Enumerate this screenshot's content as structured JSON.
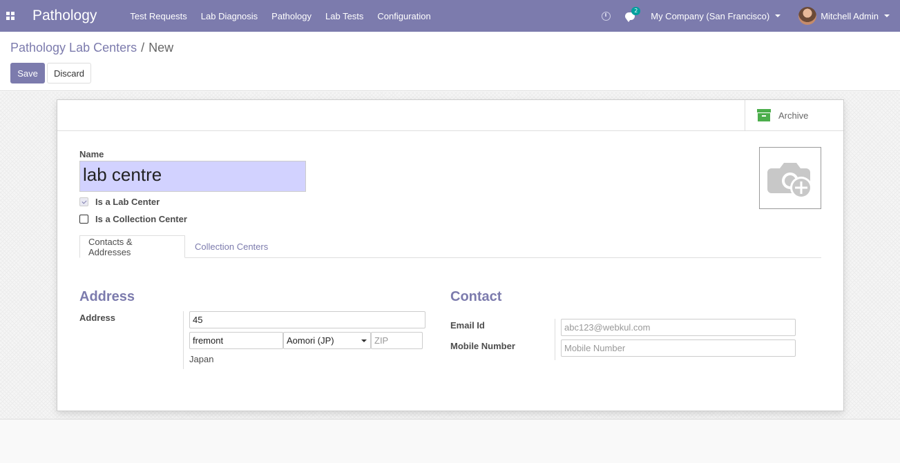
{
  "navbar": {
    "brand": "Pathology",
    "menu": [
      "Test Requests",
      "Lab Diagnosis",
      "Pathology",
      "Lab Tests",
      "Configuration"
    ],
    "chat_count": "2",
    "company": "My Company (San Francisco)",
    "user": "Mitchell Admin"
  },
  "breadcrumb": {
    "parent": "Pathology Lab Centers",
    "separator": "/",
    "current": "New"
  },
  "buttons": {
    "save": "Save",
    "discard": "Discard"
  },
  "form": {
    "archive_label": "Archive",
    "name_label": "Name",
    "name_value": "lab centre",
    "is_lab_center_label": "Is a Lab Center",
    "is_lab_center": true,
    "is_collection_center_label": "Is a Collection Center",
    "is_collection_center": false,
    "tabs": [
      "Contacts & Addresses",
      "Collection Centers"
    ],
    "address": {
      "title": "Address",
      "label": "Address",
      "street": "45",
      "city": "fremont",
      "state": "Aomori (JP)",
      "zip_placeholder": "ZIP",
      "country": "Japan"
    },
    "contact": {
      "title": "Contact",
      "email_label": "Email Id",
      "email_placeholder": "abc123@webkul.com",
      "mobile_label": "Mobile Number",
      "mobile_placeholder": "Mobile Number"
    }
  },
  "colors": {
    "brand": "#7c7bad",
    "name_bg": "#d2d2ff",
    "archive_green": "#4cae4c",
    "badge": "#00a09d"
  }
}
